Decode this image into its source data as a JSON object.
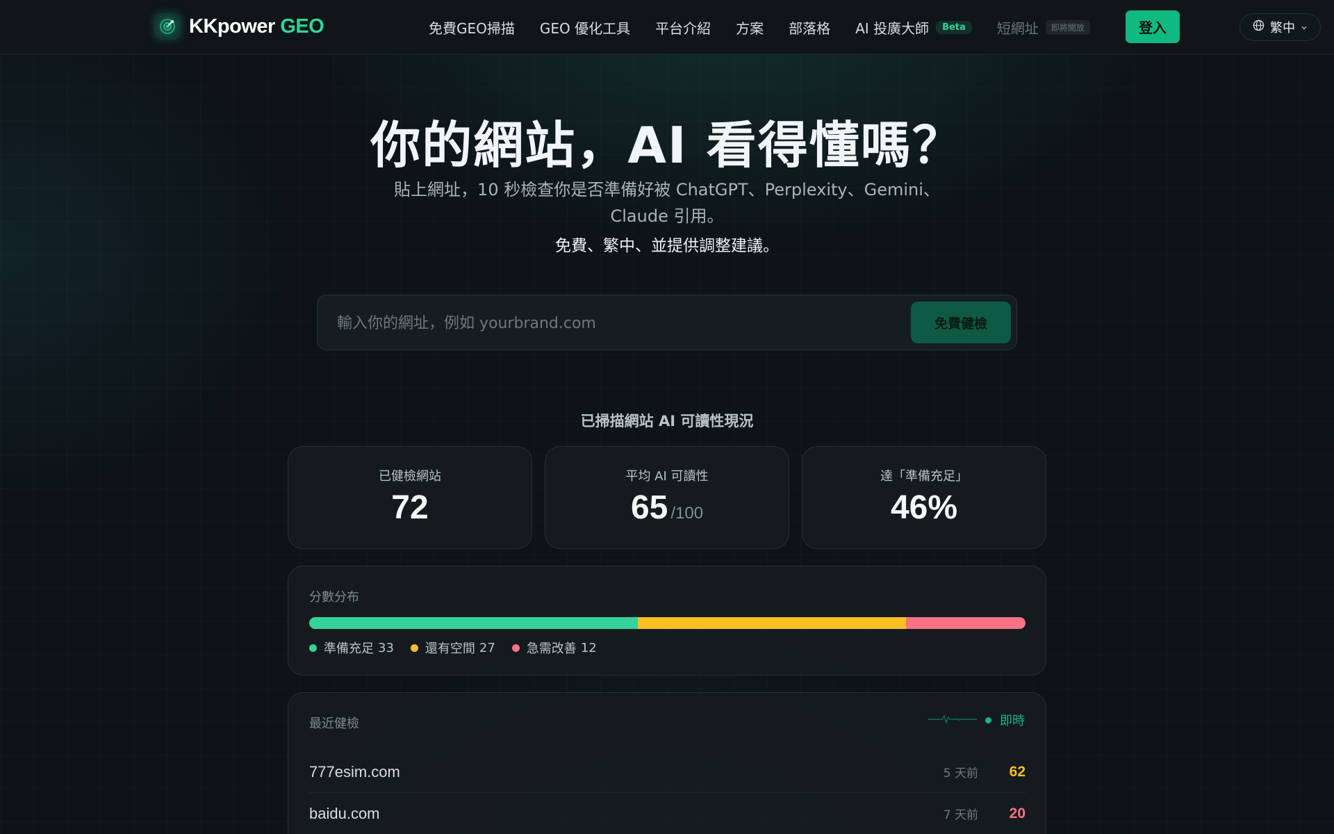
{
  "nav": {
    "brand_main": "KKpower",
    "brand_accent": "GEO",
    "links": [
      {
        "label": "免費GEO掃描"
      },
      {
        "label": "GEO 優化工具"
      },
      {
        "label": "平台介紹"
      },
      {
        "label": "方案"
      },
      {
        "label": "部落格"
      },
      {
        "label": "AI 投廣大師",
        "badge": "Beta"
      },
      {
        "label": "短網址",
        "badge": "即將開放"
      }
    ],
    "login_label": "登入",
    "language_label": "繁中"
  },
  "hero": {
    "title": "你的網站，AI 看得懂嗎？",
    "subtitle": "貼上網址，10 秒檢查你是否準備好被 ChatGPT、Perplexity、Gemini、Claude 引用。",
    "subtitle2": "免費、繁中、並提供調整建議。"
  },
  "search": {
    "placeholder": "輸入你的網址，例如 yourbrand.com",
    "value": "",
    "button_label": "免費健檢"
  },
  "stats": {
    "heading": "已掃描網站 AI 可讀性現況",
    "cards": [
      {
        "label": "已健檢網站",
        "value": "72",
        "unit": ""
      },
      {
        "label": "平均 AI 可讀性",
        "value": "65",
        "unit": "/100"
      },
      {
        "label": "達「準備充足」",
        "value": "46%",
        "unit": ""
      }
    ]
  },
  "distribution": {
    "title": "分數分布",
    "segments": [
      {
        "label": "準備充足",
        "count": 33,
        "color": "#34d399"
      },
      {
        "label": "還有空間",
        "count": 27,
        "color": "#fbbf24"
      },
      {
        "label": "急需改善",
        "count": 12,
        "color": "#fb7185"
      }
    ]
  },
  "recent": {
    "title": "最近健檢",
    "live_label": "即時",
    "items": [
      {
        "domain": "777esim.com",
        "time": "5 天前",
        "score": "62",
        "color": "#fbbf24"
      },
      {
        "domain": "baidu.com",
        "time": "7 天前",
        "score": "20",
        "color": "#fb7185"
      }
    ]
  },
  "colors": {
    "accent": "#10b981",
    "background": "#0d1316"
  },
  "icons": {
    "brand": "radar-compass-icon",
    "language": "globe-icon",
    "language_caret": "chevron-down-icon",
    "live": "pulse-line-icon"
  }
}
